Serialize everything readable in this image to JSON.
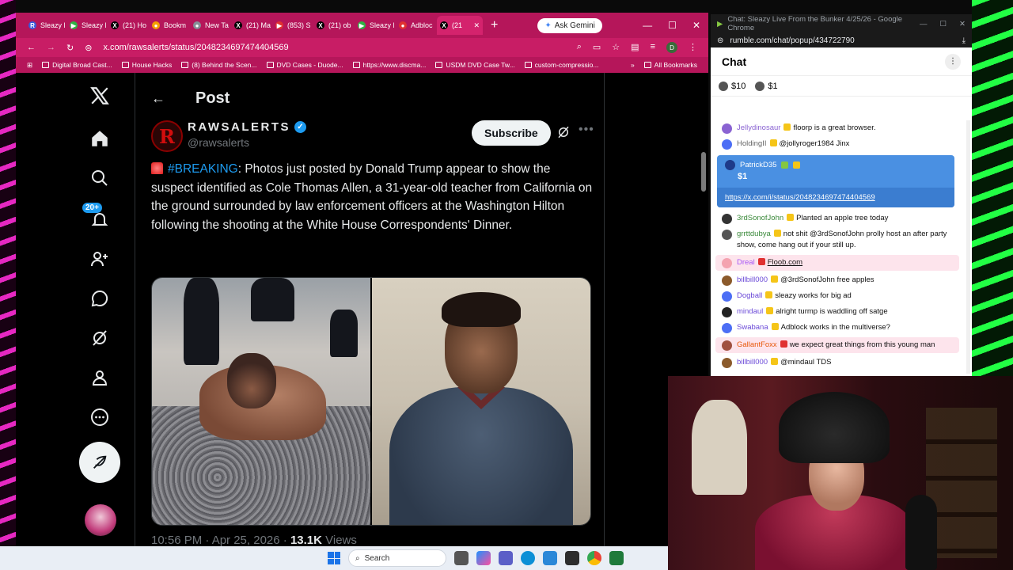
{
  "browser": {
    "tabs": [
      {
        "label": "Sleazy L",
        "color": "#3b5bdb",
        "glyph": "R"
      },
      {
        "label": "Sleazy L",
        "color": "#2fb344",
        "glyph": "▶"
      },
      {
        "label": "(21) Ho",
        "color": "#000000",
        "glyph": "X"
      },
      {
        "label": "Bookm",
        "color": "#f59f00",
        "glyph": "●"
      },
      {
        "label": "New Ta",
        "color": "#868e96",
        "glyph": "●"
      },
      {
        "label": "(21) Ma",
        "color": "#000000",
        "glyph": "X"
      },
      {
        "label": "(853) S",
        "color": "#e03131",
        "glyph": "▶"
      },
      {
        "label": "(21) ob",
        "color": "#000000",
        "glyph": "X"
      },
      {
        "label": "Sleazy L",
        "color": "#2fb344",
        "glyph": "▶"
      },
      {
        "label": "Adbloc",
        "color": "#e03131",
        "glyph": "●"
      },
      {
        "label": "(21",
        "color": "#000000",
        "glyph": "X"
      }
    ],
    "ask_gemini": "Ask Gemini",
    "url": "x.com/rawsalerts/status/2048234697474404569",
    "profile_initial": "D",
    "bookmarks": [
      "Digital Broad Cast...",
      "House Hacks",
      "(8) Behind the Scen...",
      "DVD Cases - Duode...",
      "https://www.discma...",
      "USDM DVD Case Tw...",
      "custom-compressio..."
    ],
    "all_bookmarks": "All Bookmarks"
  },
  "x": {
    "notif_badge": "20+",
    "page_title": "Post",
    "author": {
      "logo_letter": "R",
      "name": "RAWSALERTS",
      "handle": "@rawsalerts"
    },
    "subscribe_label": "Subscribe",
    "tweet": {
      "hashtag": "#BREAKING",
      "body": ": Photos just posted by Donald Trump appear to show the suspect identified as Cole Thomas Allen, a 31-year-old teacher from California on the ground surrounded by law enforcement officers at the Washington Hilton following the shooting at the White House Correspondents' Dinner."
    },
    "meta": {
      "time": "10:56 PM · Apr 25, 2026 · ",
      "views_count": "13.1K",
      "views_label": " Views"
    }
  },
  "chat": {
    "window_title": "Chat: Sleazy Live From the Bunker 4/25/26 - Google Chrome",
    "url": "rumble.com/chat/popup/434722790",
    "header": "Chat",
    "tips": [
      "$10",
      "$1"
    ],
    "messages_before": [
      {
        "user": "Jellydinosaur",
        "text": "floorp is a great browser.",
        "user_color": "#8a63d2",
        "av_color": "#8a63d2",
        "hl": false
      },
      {
        "user": "HoldingII",
        "text": "@jollyroger1984 Jinx",
        "user_color": "#666666",
        "av_color": "#4c6ef5",
        "hl": false,
        "mention": true
      }
    ],
    "paid": {
      "user": "PatrickD35",
      "amount": "$1",
      "link": "https://x.com/i/status/2048234697474404569"
    },
    "messages_after": [
      {
        "user": "3rdSonofJohn",
        "text": "Planted an apple tree today",
        "user_color": "#3b8a3b",
        "av_color": "#333333",
        "hl": false
      },
      {
        "user": "grrttdubya",
        "text": "not shit @3rdSonofJohn prolly host an after party show, come hang out if your still up.",
        "user_color": "#3b8a3b",
        "av_color": "#555555",
        "hl": false
      },
      {
        "user": "Dreal",
        "text": "Floob.com",
        "user_color": "#a855f7",
        "av_color": "#f4a3b0",
        "hl": true
      },
      {
        "user": "billbill000",
        "text": "@3rdSonofJohn free apples",
        "user_color": "#6b4ad8",
        "av_color": "#8b5a2b",
        "hl": false
      },
      {
        "user": "Dogball",
        "text": "sleazy works for big ad",
        "user_color": "#6b4ad8",
        "av_color": "#4c6ef5",
        "hl": false
      },
      {
        "user": "mindaul",
        "text": "alright turmp is waddling off satge",
        "user_color": "#6b4ad8",
        "av_color": "#222222",
        "hl": false
      },
      {
        "user": "Swabana",
        "text": "Adblock works in the multiverse?",
        "user_color": "#6b4ad8",
        "av_color": "#4c6ef5",
        "hl": false
      },
      {
        "user": "GallantFoxx",
        "text": "we expect great things from this young man",
        "user_color": "#e8590c",
        "av_color": "#a05040",
        "hl": true
      },
      {
        "user": "billbill000",
        "text": "@mindaul TDS",
        "user_color": "#6b4ad8",
        "av_color": "#8b5a2b",
        "hl": false
      }
    ]
  },
  "taskbar": {
    "search": "Search"
  }
}
